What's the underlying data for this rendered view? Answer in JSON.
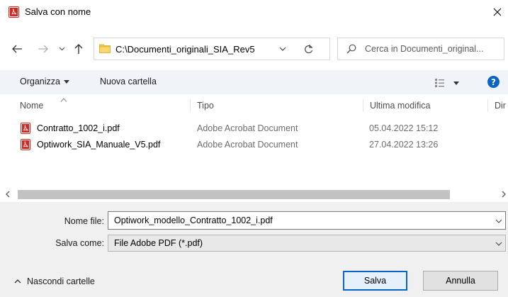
{
  "window": {
    "title": "Salva con nome"
  },
  "nav": {
    "address": "C:\\Documenti_originali_SIA_Rev5",
    "search_placeholder": "Cerca in Documenti_original..."
  },
  "toolbar": {
    "organize_label": "Organizza",
    "new_folder_label": "Nuova cartella"
  },
  "columns": {
    "name": "Nome",
    "type": "Tipo",
    "modified": "Ultima modifica",
    "dimension": "Dir"
  },
  "files": [
    {
      "name": "Contratto_1002_i.pdf",
      "type": "Adobe Acrobat Document",
      "modified": "05.04.2022 15:12"
    },
    {
      "name": "Optiwork_SIA_Manuale_V5.pdf",
      "type": "Adobe Acrobat Document",
      "modified": "27.04.2022 13:26"
    }
  ],
  "form": {
    "filename_label": "Nome file:",
    "filename_value": "Optiwork_modello_Contratto_1002_i.pdf",
    "savetype_label": "Salva come:",
    "savetype_value": "File Adobe PDF (*.pdf)",
    "hide_folders_label": "Nascondi cartelle",
    "save_label": "Salva",
    "cancel_label": "Annulla"
  },
  "colors": {
    "accent": "#0a64c6",
    "pdf_red": "#d7261f",
    "folder_yellow": "#f4c64d"
  },
  "icons": {
    "title": "pdf-icon",
    "close": "close-icon",
    "back": "arrow-left-icon",
    "forward": "arrow-right-icon",
    "recent": "chevron-down-icon",
    "up": "arrow-up-icon",
    "folder": "folder-icon",
    "refresh": "refresh-icon",
    "search": "search-icon",
    "view": "view-options-icon",
    "help": "help-icon"
  }
}
